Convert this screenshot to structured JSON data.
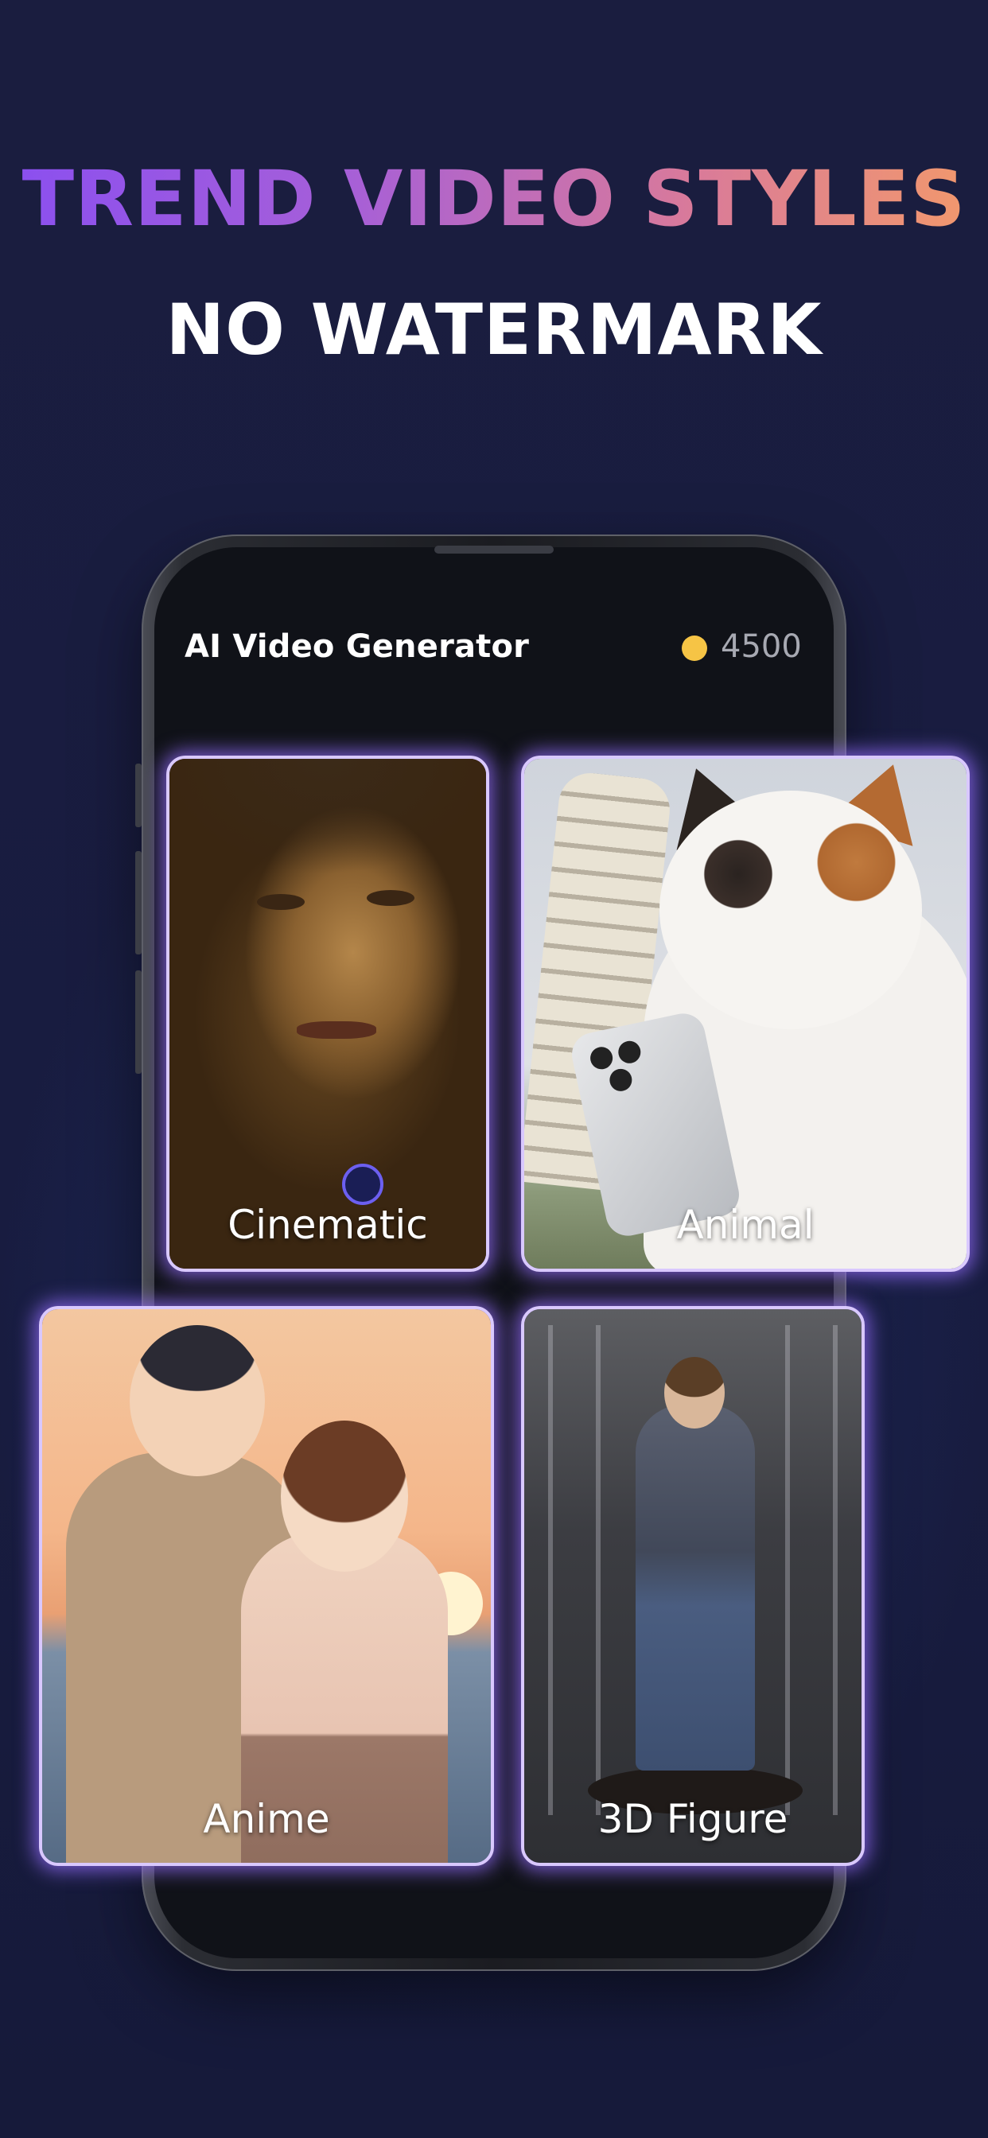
{
  "headline": "TREND VIDEO STYLES",
  "subheadline": "NO WATERMARK",
  "app": {
    "title": "AI Video Generator",
    "coins": "4500"
  },
  "cards": [
    {
      "label": "Cinematic"
    },
    {
      "label": "Animal"
    },
    {
      "label": "Anime"
    },
    {
      "label": "3D Figure"
    }
  ],
  "colors": {
    "background": "#191c3d",
    "headline_gradient_start": "#8a4ff0",
    "headline_gradient_end": "#f39a6a",
    "card_glow": "#966eff",
    "coin": "#f6c445"
  }
}
